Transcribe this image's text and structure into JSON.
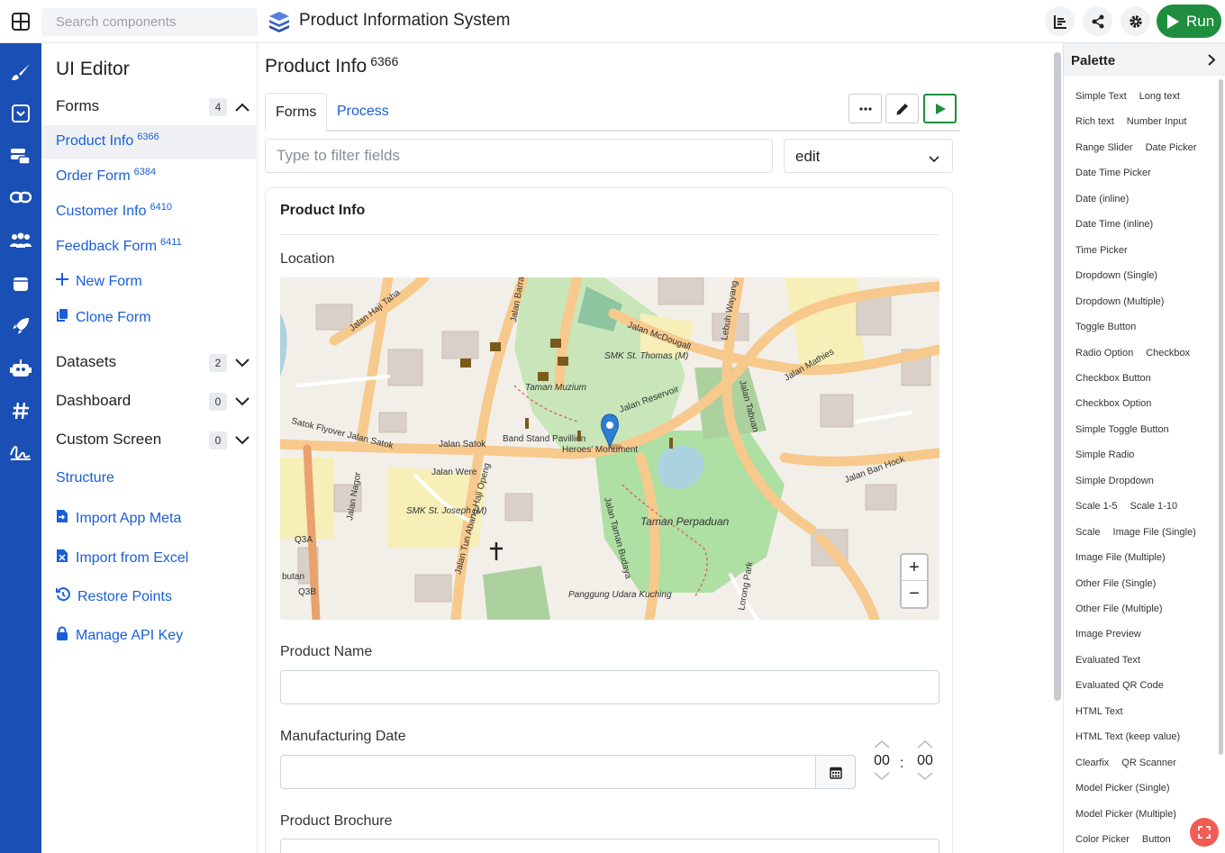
{
  "search": {
    "placeholder": "Search components"
  },
  "app": {
    "title": "Product Information System"
  },
  "toolbar": {
    "run_label": "Run"
  },
  "sidebar": {
    "title": "UI Editor",
    "forms_label": "Forms",
    "forms_count": "4",
    "forms": [
      {
        "label": "Product Info",
        "id": "6366"
      },
      {
        "label": "Order Form",
        "id": "6384"
      },
      {
        "label": "Customer Info",
        "id": "6410"
      },
      {
        "label": "Feedback Form",
        "id": "6411"
      }
    ],
    "new_form": "New Form",
    "clone_form": "Clone Form",
    "datasets_label": "Datasets",
    "datasets_count": "2",
    "dashboard_label": "Dashboard",
    "dashboard_count": "0",
    "custom_screen_label": "Custom Screen",
    "custom_screen_count": "0",
    "structure": "Structure",
    "import_meta": "Import App Meta",
    "import_excel": "Import from Excel",
    "restore_points": "Restore Points",
    "manage_api": "Manage API Key"
  },
  "main": {
    "title": "Product Info",
    "title_id": "6366",
    "tabs": [
      "Forms",
      "Process"
    ],
    "filter_placeholder": "Type to filter fields",
    "mode": "edit",
    "card_title": "Product Info",
    "fields": {
      "location": "Location",
      "product_name": "Product Name",
      "manufacturing_date": "Manufacturing Date",
      "product_brochure": "Product Brochure"
    },
    "time": {
      "hours": "00",
      "sep": ":",
      "minutes": "00"
    }
  },
  "map": {
    "labels": [
      "Jalan Haji Taha",
      "Jalan Barra",
      "Jalan McDougall",
      "Lebuh Wayang",
      "SMK St. Thomas (M)",
      "Taman Muzium",
      "Jalan Reservoir",
      "Jalan Tabuan",
      "Jalan Mathies",
      "Satok Flyover Jalan Satok",
      "Jalan Satok",
      "Band Stand Pavillion",
      "Heroes' Monument",
      "Jalan Were",
      "Jalan Nagor",
      "SMK St. Joseph (M)",
      "Jalan Tun Abang Haji Openg",
      "Jalan Taman Budaya",
      "Taman Perpaduan",
      "Jalan Ban Hock",
      "Q3A",
      "Q3B",
      "butan",
      "Panggung Udara Kuching",
      "Lorong Park"
    ],
    "zoom_in": "+",
    "zoom_out": "−"
  },
  "palette": {
    "title": "Palette",
    "rows": [
      [
        "Simple Text",
        "Long text"
      ],
      [
        "Rich text",
        "Number Input"
      ],
      [
        "Range Slider",
        "Date Picker"
      ],
      [
        "Date Time Picker"
      ],
      [
        "Date (inline)"
      ],
      [
        "Date Time (inline)"
      ],
      [
        "Time Picker"
      ],
      [
        "Dropdown (Single)"
      ],
      [
        "Dropdown (Multiple)"
      ],
      [
        "Toggle Button"
      ],
      [
        "Radio Option",
        "Checkbox"
      ],
      [
        "Checkbox Button"
      ],
      [
        "Checkbox Option"
      ],
      [
        "Simple Toggle Button"
      ],
      [
        "Simple Radio"
      ],
      [
        "Simple Dropdown"
      ],
      [
        "Scale 1-5",
        "Scale 1-10"
      ],
      [
        "Scale",
        "Image File (Single)"
      ],
      [
        "Image File (Multiple)"
      ],
      [
        "Other File (Single)"
      ],
      [
        "Other File (Multiple)"
      ],
      [
        "Image Preview"
      ],
      [
        "Evaluated Text"
      ],
      [
        "Evaluated QR Code"
      ],
      [
        "HTML Text"
      ],
      [
        "HTML Text (keep value)"
      ],
      [
        "Clearfix",
        "QR Scanner"
      ],
      [
        "Model Picker (Single)"
      ],
      [
        "Model Picker (Multiple)"
      ],
      [
        "Color Picker",
        "Button"
      ]
    ]
  },
  "colors": {
    "rail": "#1a4fb5",
    "accent": "#1a5fd6",
    "run": "#1e8e3e"
  }
}
